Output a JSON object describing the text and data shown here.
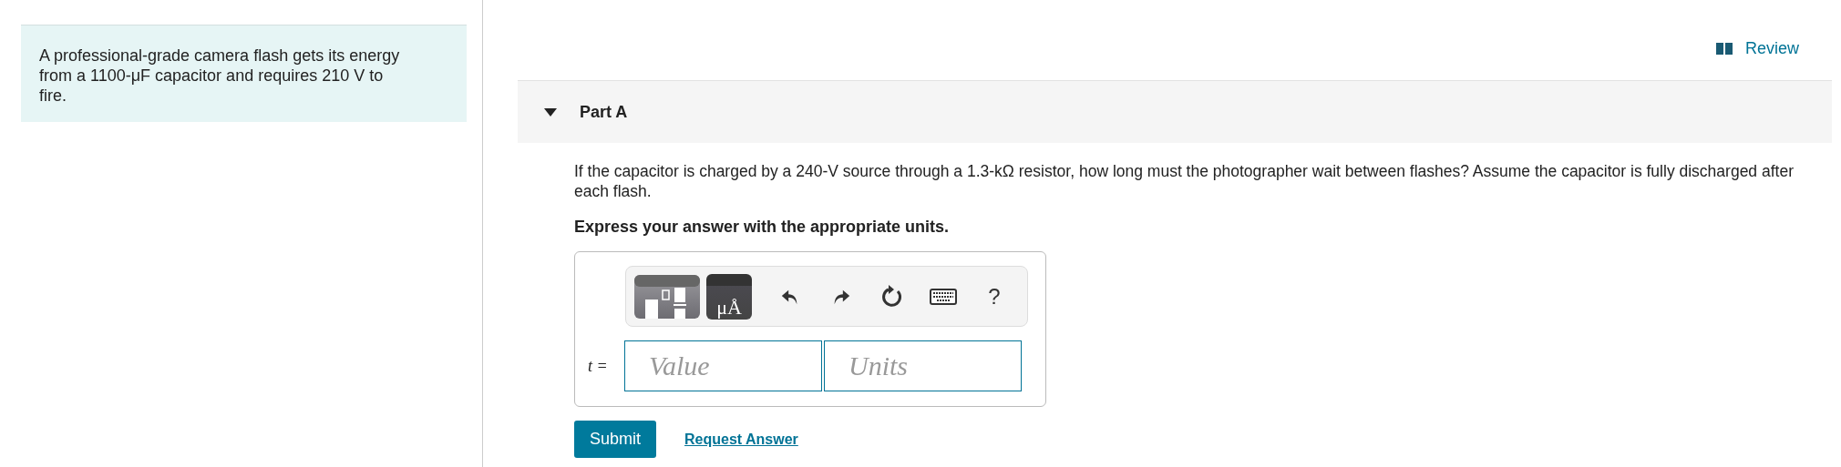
{
  "intro": {
    "text": "A professional-grade camera flash gets its energy from a 1100-μF capacitor and requires 210 V to fire."
  },
  "review_link": {
    "label": "Review"
  },
  "part": {
    "title": "Part A",
    "expanded": true,
    "question": "If the capacitor is charged by a 240-V source through a 1.3-kΩ resistor, how long must the photographer wait between flashes? Assume the capacitor is fully discharged after each flash.",
    "instruction": "Express your answer with the appropriate units.",
    "toolbar": [
      {
        "kind": "templates"
      },
      {
        "kind": "units",
        "label": "μÅ"
      },
      {
        "kind": "undo"
      },
      {
        "kind": "redo"
      },
      {
        "kind": "reset"
      },
      {
        "kind": "keyboard"
      },
      {
        "kind": "help",
        "label": "?"
      }
    ],
    "variable": "t =",
    "fields": [
      {
        "placeholder": "Value"
      },
      {
        "placeholder": "Units"
      }
    ],
    "buttons": [
      {
        "kind": "submit",
        "label": "Submit"
      },
      {
        "kind": "link",
        "label": "Request Answer"
      }
    ]
  }
}
